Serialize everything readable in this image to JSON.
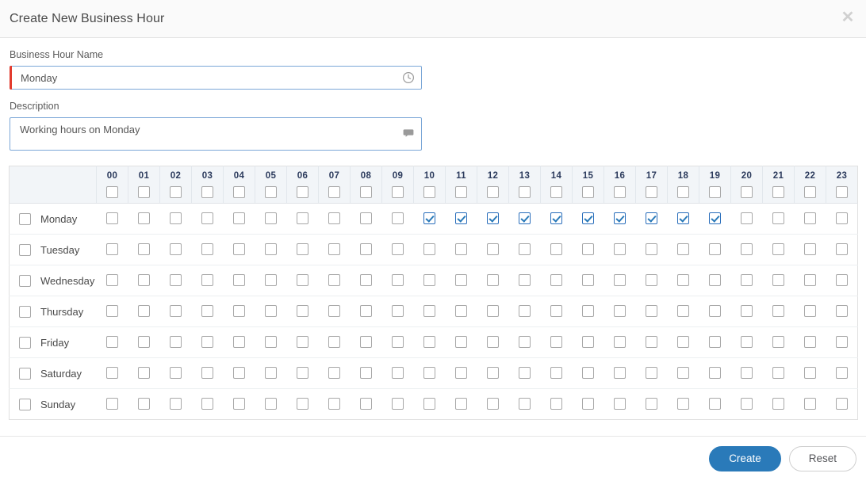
{
  "dialog": {
    "title": "Create New Business Hour",
    "close_icon": "close-icon"
  },
  "form": {
    "name": {
      "label": "Business Hour Name",
      "value": "Monday",
      "placeholder": "",
      "icon": "clock-icon",
      "required": true
    },
    "description": {
      "label": "Description",
      "value": "Working hours on Monday",
      "placeholder": "",
      "icon": "comment-icon",
      "required": false
    }
  },
  "schedule": {
    "hours": [
      "00",
      "01",
      "02",
      "03",
      "04",
      "05",
      "06",
      "07",
      "08",
      "09",
      "10",
      "11",
      "12",
      "13",
      "14",
      "15",
      "16",
      "17",
      "18",
      "19",
      "20",
      "21",
      "22",
      "23"
    ],
    "header_checked": [
      false,
      false,
      false,
      false,
      false,
      false,
      false,
      false,
      false,
      false,
      false,
      false,
      false,
      false,
      false,
      false,
      false,
      false,
      false,
      false,
      false,
      false,
      false,
      false
    ],
    "rows": [
      {
        "day": "Monday",
        "selected": false,
        "hours": [
          false,
          false,
          false,
          false,
          false,
          false,
          false,
          false,
          false,
          false,
          true,
          true,
          true,
          true,
          true,
          true,
          true,
          true,
          true,
          true,
          false,
          false,
          false,
          false
        ]
      },
      {
        "day": "Tuesday",
        "selected": false,
        "hours": [
          false,
          false,
          false,
          false,
          false,
          false,
          false,
          false,
          false,
          false,
          false,
          false,
          false,
          false,
          false,
          false,
          false,
          false,
          false,
          false,
          false,
          false,
          false,
          false
        ]
      },
      {
        "day": "Wednesday",
        "selected": false,
        "hours": [
          false,
          false,
          false,
          false,
          false,
          false,
          false,
          false,
          false,
          false,
          false,
          false,
          false,
          false,
          false,
          false,
          false,
          false,
          false,
          false,
          false,
          false,
          false,
          false
        ]
      },
      {
        "day": "Thursday",
        "selected": false,
        "hours": [
          false,
          false,
          false,
          false,
          false,
          false,
          false,
          false,
          false,
          false,
          false,
          false,
          false,
          false,
          false,
          false,
          false,
          false,
          false,
          false,
          false,
          false,
          false,
          false
        ]
      },
      {
        "day": "Friday",
        "selected": false,
        "hours": [
          false,
          false,
          false,
          false,
          false,
          false,
          false,
          false,
          false,
          false,
          false,
          false,
          false,
          false,
          false,
          false,
          false,
          false,
          false,
          false,
          false,
          false,
          false,
          false
        ]
      },
      {
        "day": "Saturday",
        "selected": false,
        "hours": [
          false,
          false,
          false,
          false,
          false,
          false,
          false,
          false,
          false,
          false,
          false,
          false,
          false,
          false,
          false,
          false,
          false,
          false,
          false,
          false,
          false,
          false,
          false,
          false
        ]
      },
      {
        "day": "Sunday",
        "selected": false,
        "hours": [
          false,
          false,
          false,
          false,
          false,
          false,
          false,
          false,
          false,
          false,
          false,
          false,
          false,
          false,
          false,
          false,
          false,
          false,
          false,
          false,
          false,
          false,
          false,
          false
        ]
      }
    ]
  },
  "footer": {
    "create_label": "Create",
    "reset_label": "Reset"
  },
  "colors": {
    "accent": "#2a7ab9",
    "checkbox_checked": "#2a6ebb",
    "required_marker": "#e23b2e",
    "input_border": "#7ba7d7",
    "header_bg": "#f2f5f8",
    "hour_label": "#2b3a5c"
  }
}
